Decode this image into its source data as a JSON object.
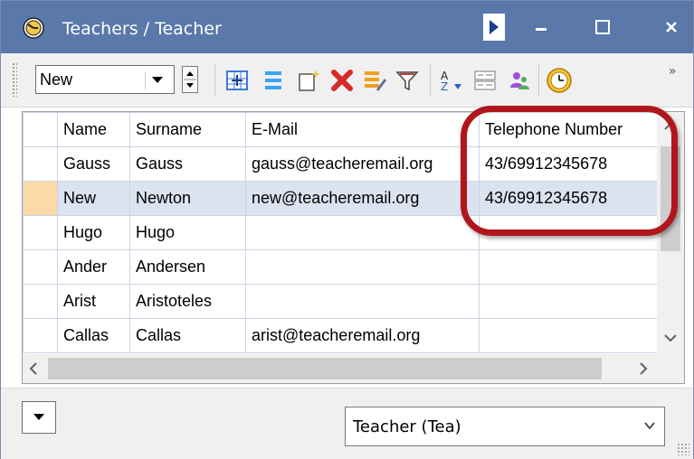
{
  "window": {
    "title": "Teachers / Teacher"
  },
  "toolbar": {
    "combo_value": "New",
    "overflow_label": "»"
  },
  "grid": {
    "columns": [
      "Name",
      "Surname",
      "E-Mail",
      "Telephone Number"
    ],
    "rows": [
      {
        "name": "Gauss",
        "surname": "Gauss",
        "email": "gauss@teacheremail.org",
        "phone": "43/69912345678"
      },
      {
        "name": "New",
        "surname": "Newton",
        "email": "new@teacheremail.org",
        "phone": "43/69912345678"
      },
      {
        "name": "Hugo",
        "surname": "Hugo",
        "email": "",
        "phone": ""
      },
      {
        "name": "Ander",
        "surname": "Andersen",
        "email": "",
        "phone": ""
      },
      {
        "name": "Arist",
        "surname": "Aristoteles",
        "email": "",
        "phone": ""
      },
      {
        "name": "Callas",
        "surname": "Callas",
        "email": "arist@teacheremail.org",
        "phone": ""
      }
    ]
  },
  "bottom": {
    "type_select_value": "Teacher (Tea)"
  },
  "colors": {
    "titlebar": "#5a78aa",
    "selected_row": "#dce3f0",
    "selected_indicator": "#fdd9a8",
    "callout": "#b0161b"
  }
}
